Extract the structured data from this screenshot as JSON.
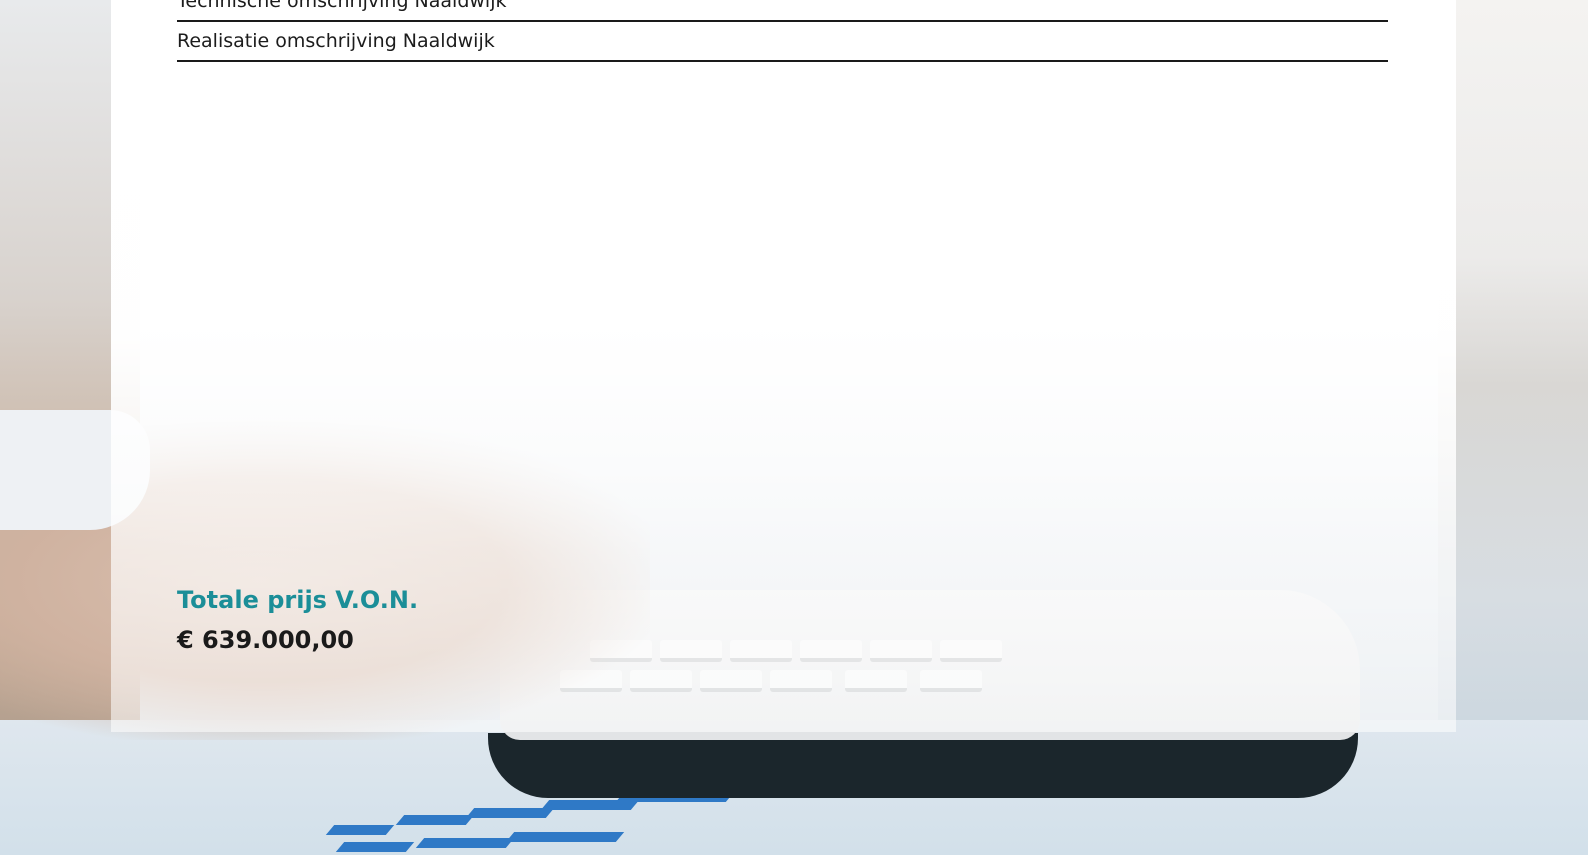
{
  "documents": [
    {
      "label": "Technische omschrijving Naaldwijk"
    },
    {
      "label": "Realisatie omschrijving Naaldwijk"
    }
  ],
  "price": {
    "label": "Totale prijs V.O.N.",
    "value": "€ 639.000,00"
  },
  "colors": {
    "accent": "#1b8e98",
    "text": "#1a1a1a"
  }
}
